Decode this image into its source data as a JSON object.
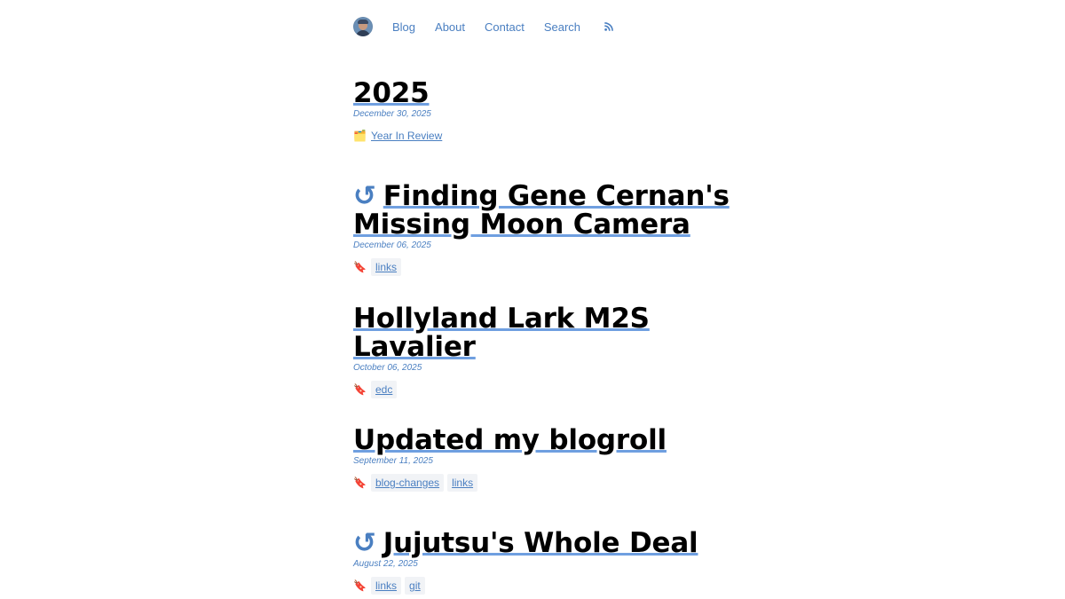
{
  "nav": {
    "items": [
      {
        "label": "Blog"
      },
      {
        "label": "About"
      },
      {
        "label": "Contact"
      },
      {
        "label": "Search"
      }
    ],
    "rss_icon": "rss-icon"
  },
  "posts": [
    {
      "title": "2025",
      "external": false,
      "date": "December 30, 2025",
      "link_icon": "🗂️",
      "link": "Year In Review",
      "tags": []
    },
    {
      "title": "Finding Gene Cernan's Missing Moon Camera",
      "external": true,
      "ext_glyph": "↺",
      "date": "December 06, 2025",
      "tag_icon": "🔖",
      "tags": [
        "links"
      ]
    },
    {
      "title": "Hollyland Lark M2S Lavalier",
      "external": false,
      "date": "October 06, 2025",
      "tag_icon": "🔖",
      "tags": [
        "edc"
      ]
    },
    {
      "title": "Updated my blogroll",
      "external": false,
      "date": "September 11, 2025",
      "tag_icon": "🔖",
      "tags": [
        "blog-changes",
        "links"
      ]
    },
    {
      "title": "Jujutsu's Whole Deal",
      "external": true,
      "ext_glyph": "↺",
      "date": "August 22, 2025",
      "tag_icon": "🔖",
      "tags": [
        "links",
        "git"
      ]
    }
  ],
  "colors": {
    "link": "#4a7fc1",
    "underline": "#6f9fe0",
    "tag_bg": "#f1f3f6"
  }
}
